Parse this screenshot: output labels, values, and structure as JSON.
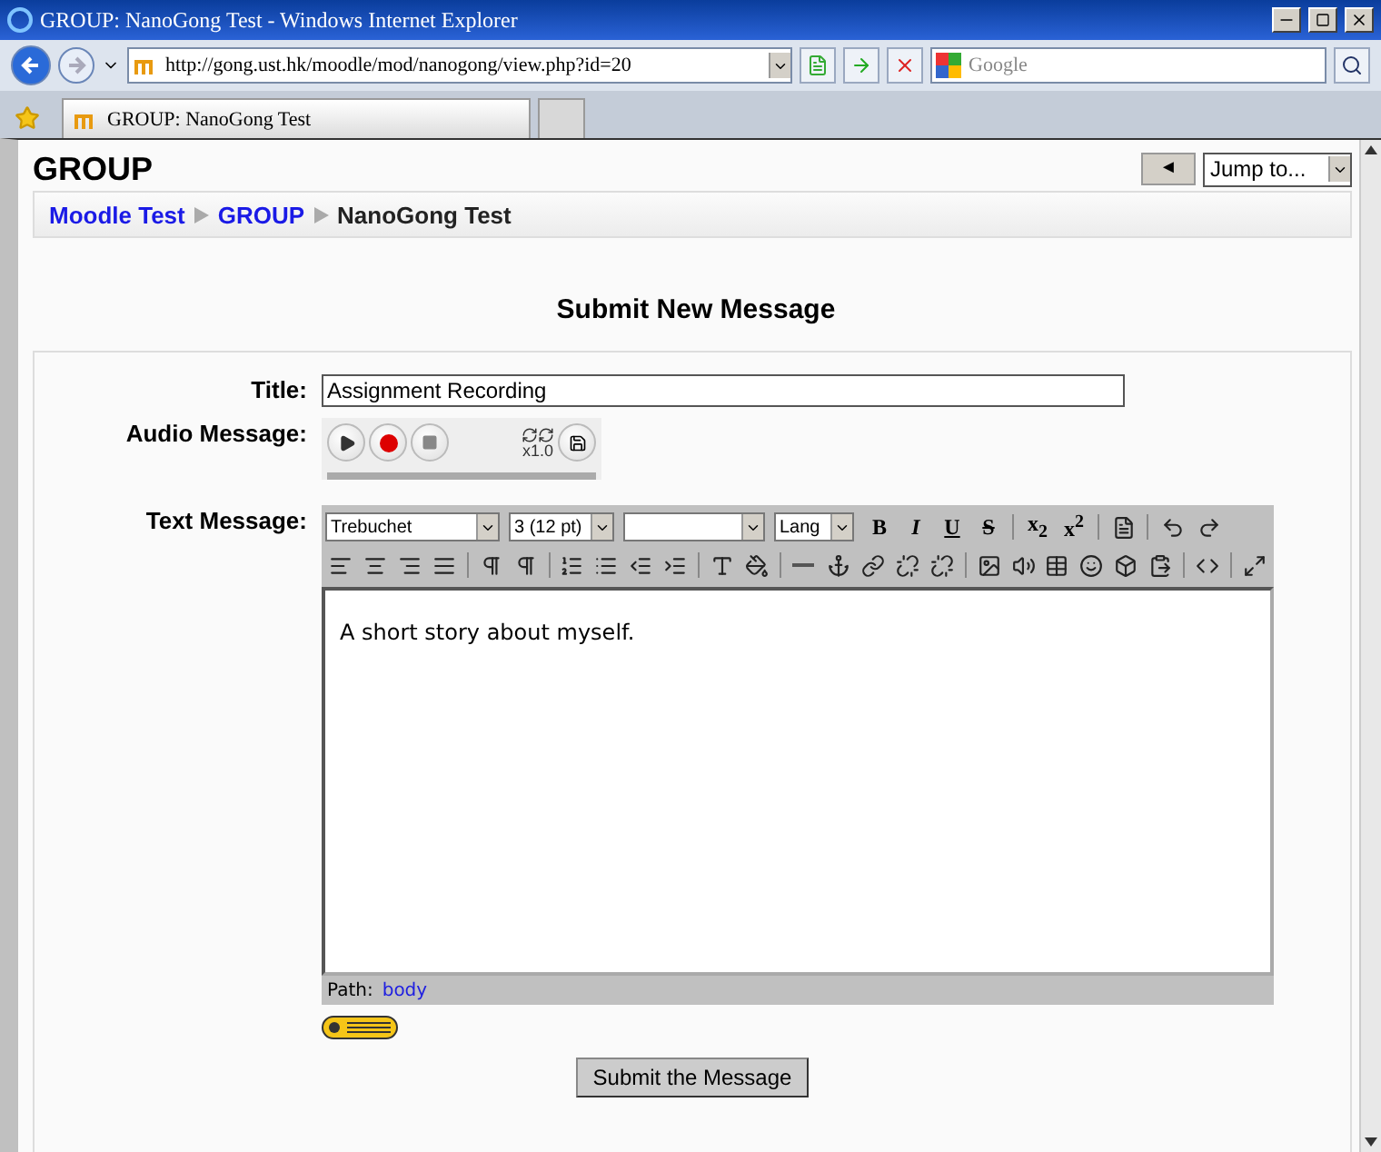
{
  "window": {
    "title": "GROUP: NanoGong Test - Windows Internet Explorer"
  },
  "address_bar": {
    "url": "http://gong.ust.hk/moodle/mod/nanogong/view.php?id=20"
  },
  "search": {
    "placeholder": "Google"
  },
  "tabs": [
    {
      "label": "GROUP: NanoGong Test",
      "selected": true
    }
  ],
  "page": {
    "course": "GROUP",
    "back_button": "◄",
    "jump_menu": "Jump to...",
    "breadcrumb": [
      {
        "label": "Moodle Test",
        "link": true
      },
      {
        "label": "GROUP",
        "link": true
      },
      {
        "label": "NanoGong Test",
        "link": false
      }
    ],
    "heading": "Submit New Message",
    "form": {
      "title_label": "Title:",
      "title_value": "Assignment Recording",
      "audio_label": "Audio Message:",
      "audio_speed": "x1.0",
      "audio_progress": {
        "level": 0
      },
      "text_label": "Text Message:",
      "editor": {
        "font": "Trebuchet",
        "size": "3 (12 pt)",
        "lang": "Lang",
        "format_buttons": [
          {
            "label": "B",
            "kind": "bold"
          },
          {
            "label": "I",
            "kind": "italic"
          },
          {
            "label": "U",
            "kind": "underline"
          },
          {
            "label": "S",
            "kind": "strike"
          },
          {
            "label": "x$_{2}$",
            "kind": "plain"
          },
          {
            "label": "x$^{2}$",
            "kind": "plain"
          }
        ],
        "content": "A short story about myself.",
        "path_label": "Path:",
        "path_value": "body"
      },
      "submit": "Submit the Message"
    }
  }
}
